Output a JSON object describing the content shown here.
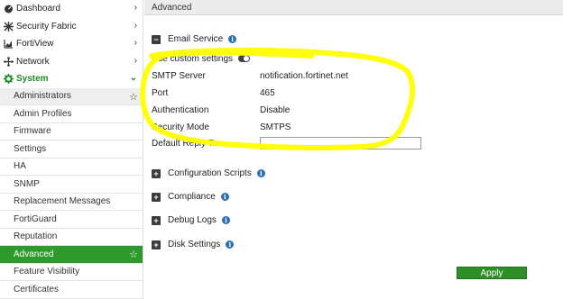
{
  "sidebar": {
    "top_items": [
      {
        "label": "Dashboard",
        "icon": "dashboard-icon"
      },
      {
        "label": "Security Fabric",
        "icon": "security-fabric-icon"
      },
      {
        "label": "FortiView",
        "icon": "fortiview-icon"
      },
      {
        "label": "Network",
        "icon": "network-icon"
      }
    ],
    "system": {
      "label": "System",
      "icon": "system-gear-icon"
    },
    "sub_items": [
      {
        "label": "Administrators"
      },
      {
        "label": "Admin Profiles"
      },
      {
        "label": "Firmware"
      },
      {
        "label": "Settings"
      },
      {
        "label": "HA"
      },
      {
        "label": "SNMP"
      },
      {
        "label": "Replacement Messages"
      },
      {
        "label": "FortiGuard"
      },
      {
        "label": "Reputation"
      },
      {
        "label": "Advanced"
      },
      {
        "label": "Feature Visibility"
      },
      {
        "label": "Certificates"
      }
    ]
  },
  "header": {
    "title": "Advanced"
  },
  "email_service": {
    "title": "Email Service",
    "use_custom_label": "Use custom settings",
    "fields": [
      {
        "label": "SMTP Server",
        "value": "notification.fortinet.net"
      },
      {
        "label": "Port",
        "value": "465"
      },
      {
        "label": "Authentication",
        "value": "Disable"
      },
      {
        "label": "Security Mode",
        "value": "SMTPS"
      }
    ],
    "reply_to_label": "Default Reply To",
    "reply_to_value": ""
  },
  "sections": [
    {
      "title": "Configuration Scripts"
    },
    {
      "title": "Compliance"
    },
    {
      "title": "Debug Logs"
    },
    {
      "title": "Disk Settings"
    }
  ],
  "apply_label": "Apply",
  "colors": {
    "accent": "#2e9a2b",
    "info": "#2b6fb6",
    "highlight": "#ffff00"
  }
}
